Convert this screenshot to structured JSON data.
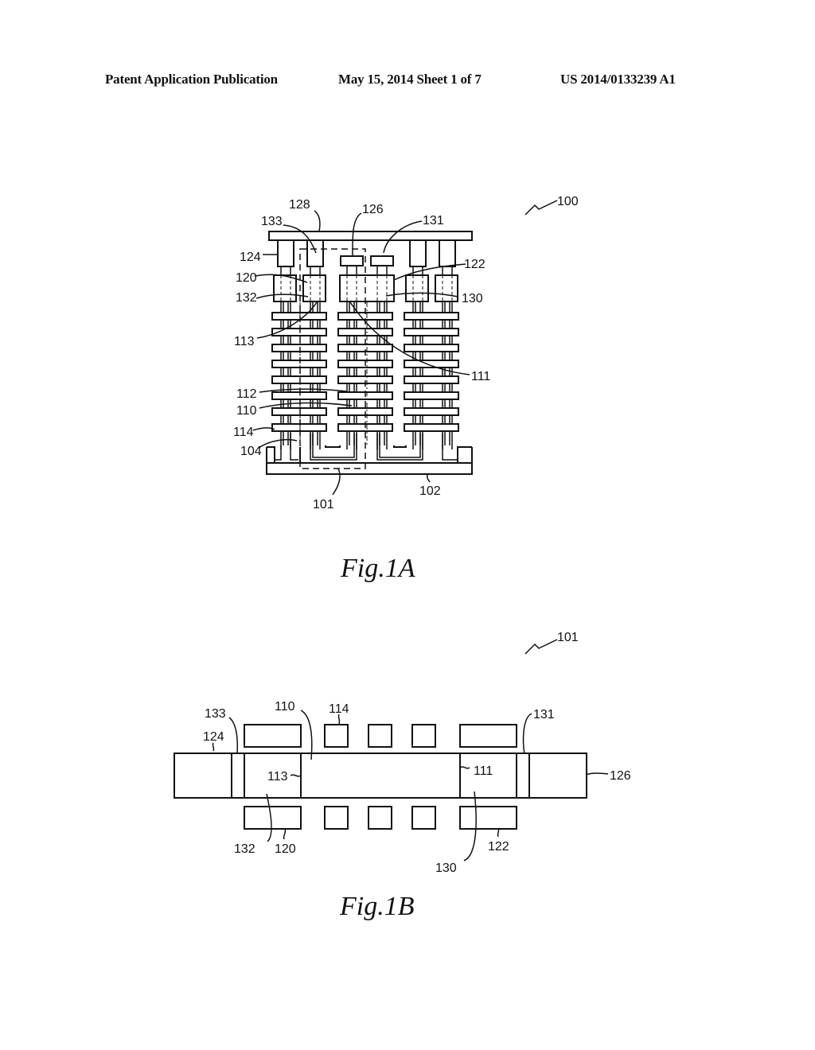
{
  "header": {
    "left": "Patent Application Publication",
    "middle": "May 15, 2014   Sheet 1 of 7",
    "right": "US 2014/0133239 A1"
  },
  "figure_1a": {
    "caption": "Fig.1A",
    "ref": "100",
    "labels": {
      "l128": "128",
      "l133": "133",
      "l126": "126",
      "l131": "131",
      "l124": "124",
      "l122": "122",
      "l120": "120",
      "l132": "132",
      "l130": "130",
      "l113": "113",
      "l111": "111",
      "l112": "112",
      "l110": "110",
      "l114": "114",
      "l104": "104",
      "l101": "101",
      "l102": "102"
    }
  },
  "figure_1b": {
    "caption": "Fig.1B",
    "ref": "101",
    "labels": {
      "l133": "133",
      "l110": "110",
      "l114": "114",
      "l131": "131",
      "l124": "124",
      "l113": "113",
      "l111": "111",
      "l126": "126",
      "l132": "132",
      "l120": "120",
      "l130": "130",
      "l122": "122"
    }
  }
}
